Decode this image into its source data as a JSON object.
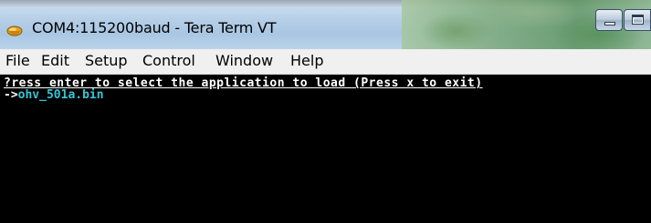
{
  "window": {
    "title": "COM4:115200baud - Tera Term VT",
    "icon": "tera-term-app-icon",
    "controls": {
      "minimize": "minimize-icon",
      "maximize": "maximize-icon"
    }
  },
  "menubar": {
    "items": [
      "File",
      "Edit",
      "Setup",
      "Control",
      "Window",
      "Help"
    ]
  },
  "terminal": {
    "lines": [
      "?ress enter to select the application to load (Press x to exit)",
      {
        "prompt": "->",
        "file": "ohv_501a.bin"
      }
    ],
    "colors": {
      "background": "#000000",
      "text": "#ffffff",
      "highlight": "#33c8d8"
    }
  }
}
